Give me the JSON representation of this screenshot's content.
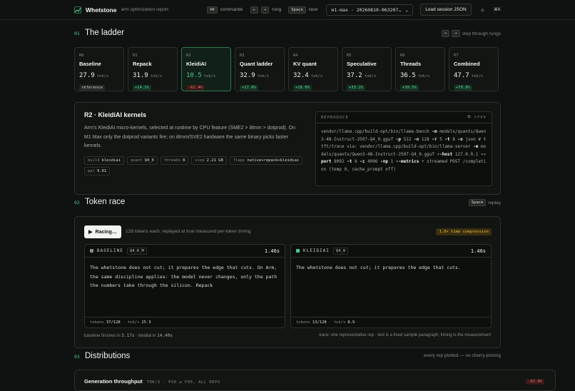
{
  "header": {
    "brand": "Whetstone",
    "subtitle": "arm optimization report",
    "kbd_commands": "⌘K",
    "commands_label": "commands",
    "kbd_prev": "←",
    "kbd_next": "→",
    "rung_label": "rung",
    "kbd_space": "Space",
    "race_label": "race",
    "session_select": "m1-max · 20260810-063207…",
    "load_button": "Load session JSON",
    "theme_icon": "sun-icon",
    "shortcut_icon": "⌘K"
  },
  "ladder": {
    "num": "01",
    "title": "The ladder",
    "hint": "step through rungs",
    "unit": "tok/s",
    "rungs": [
      {
        "code": "R0",
        "name": "Baseline",
        "value": "27.9",
        "delta": "reference",
        "kind": "neutral"
      },
      {
        "code": "R1",
        "name": "Repack",
        "value": "31.9",
        "delta": "+14.1%",
        "kind": "up"
      },
      {
        "code": "R2",
        "name": "KleidiAI",
        "value": "10.5",
        "delta": "-62.4%",
        "kind": "down"
      },
      {
        "code": "R3",
        "name": "Quant ladder",
        "value": "32.9",
        "delta": "+17.6%",
        "kind": "up"
      },
      {
        "code": "R4",
        "name": "KV quant",
        "value": "32.4",
        "delta": "+16.0%",
        "kind": "up"
      },
      {
        "code": "R5",
        "name": "Speculative",
        "value": "37.2",
        "delta": "+33.1%",
        "kind": "up"
      },
      {
        "code": "R6",
        "name": "Threads",
        "value": "36.5",
        "delta": "+30.5%",
        "kind": "up"
      },
      {
        "code": "R7",
        "name": "Combined",
        "value": "47.7",
        "delta": "+70.8%",
        "kind": "up"
      }
    ]
  },
  "kernels": {
    "title": "R2 · KleidiAI kernels",
    "description": "Arm's KleidiAI micro-kernels, selected at runtime by CPU feature (SME2 > i8mm > dotprod). On M1 Max only the dotprod variants fire; on i8mm/SVE2 hardware the same binary picks faster kernels.",
    "chips": [
      {
        "k": "build",
        "v": "kleidiai"
      },
      {
        "k": "quant",
        "v": "Q4_0"
      },
      {
        "k": "threads",
        "v": "8"
      },
      {
        "k": "size",
        "v": "2.21 GB"
      },
      {
        "k": "flags",
        "v": "native+repack+kleidiai"
      },
      {
        "k": "ppl",
        "v": "9.01"
      }
    ],
    "reproduce_label": "REPRODUCE",
    "copy_label": "copy",
    "cmd": {
      "p1": "vendor/llama.cpp/build-opt/bin/llama-bench ",
      "f_m": "-m",
      "p2": " models/quants/Qwen3-4B-Instruct-2507-Q4_0.gguf ",
      "f_p": "-p",
      "p3": " 512 ",
      "f_n": "-n",
      "p4": " 128 ",
      "f_r": "-r",
      "p5": " 5 ",
      "f_t": "-t",
      "p6": " 8 ",
      "f_o": "-o",
      "p7": " json   # ttft/trace via: vendor/llama.cpp/build-opt/bin/llama-server ",
      "f_m2": "-m",
      "p8": " models/quants/Qwen3-4B-Instruct-2507-Q4_0.gguf ",
      "f_host": "--host",
      "p9": " 127.0.0.1 ",
      "f_port": "--port",
      "p10": " 8092 ",
      "f_t2": "-t",
      "p11": " 8 ",
      "f_c": "-c",
      "p12": " 4096 ",
      "f_np": "-np",
      "p13": " 1 ",
      "f_metrics": "--metrics",
      "p14": " + streamed POST /completion (temp 0, cache_prompt off)"
    }
  },
  "race": {
    "num": "02",
    "title": "Token race",
    "kbd": "Space",
    "hint": "replay",
    "button": "Racing…",
    "note": "128 tokens each, replayed at true measured per-token timing",
    "compression": "1.8× time compression",
    "lanes": [
      {
        "label": "BASELINE",
        "quant": "Q4_K_M",
        "time": "1.46s",
        "color": "#8a8f89",
        "text": "The whetstone does not cut; it prepares the edge that cuts. On Arm, the same discipline applies: the model never changes, only the path the numbers take through the silicon. Repack",
        "tokens": "37/128",
        "toks": "25.3"
      },
      {
        "label": "KLEIDIAI",
        "quant": "Q4_0",
        "time": "1.46s",
        "color": "#4fc98a",
        "text": "The whetstone does not cut; it prepares the edge that cuts.",
        "tokens": "13/128",
        "toks": "8.9"
      }
    ],
    "tokens_label": "tokens",
    "toks_label": "tok/s",
    "foot_prefix": "baseline finishes in",
    "foot_base": "5.17s",
    "foot_mid": "· kleidiai in",
    "foot_kleidi": "14.40s",
    "foot_right": "trace: one representative rep · text is a fixed sample paragraph; timing is the measurement"
  },
  "dist": {
    "num": "03",
    "title": "Distributions",
    "hint": "every rep plotted — no cherry-picking",
    "card_title": "Generation throughput",
    "card_sub": "TOK/S · P50 ± P95, ALL REPS",
    "badge": "-62.4%"
  }
}
